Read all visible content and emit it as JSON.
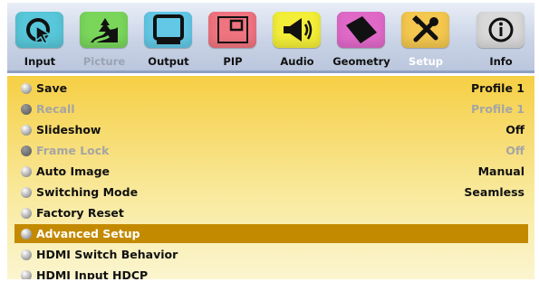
{
  "tabs": [
    {
      "label": "Input",
      "icon": "input-cursor-icon",
      "color": "#57c7d9"
    },
    {
      "label": "Picture",
      "icon": "picture-landscape-icon",
      "color": "#79d65b"
    },
    {
      "label": "Output",
      "icon": "output-monitor-icon",
      "color": "#62c8e6"
    },
    {
      "label": "PIP",
      "icon": "pip-window-icon",
      "color": "#f0747f"
    },
    {
      "label": "Audio",
      "icon": "audio-speaker-icon",
      "color": "#f3ee38"
    },
    {
      "label": "Geometry",
      "icon": "geometry-rhombus-icon",
      "color": "#e069c8"
    },
    {
      "label": "Setup",
      "icon": "setup-tools-icon",
      "color": "#f4c74f"
    },
    {
      "label": "Info",
      "icon": "info-icon",
      "color": "#d9d9d9"
    }
  ],
  "active_tab": "Setup",
  "menu": [
    {
      "label": "Save",
      "value": "Profile 1",
      "state": "enabled"
    },
    {
      "label": "Recall",
      "value": "Profile 1",
      "state": "disabled"
    },
    {
      "label": "Slideshow",
      "value": "Off",
      "state": "enabled"
    },
    {
      "label": "Frame Lock",
      "value": "Off",
      "state": "disabled"
    },
    {
      "label": "Auto Image",
      "value": "Manual",
      "state": "enabled"
    },
    {
      "label": "Switching Mode",
      "value": "Seamless",
      "state": "enabled"
    },
    {
      "label": "Factory Reset",
      "value": "",
      "state": "enabled"
    },
    {
      "label": "Advanced Setup",
      "value": "",
      "state": "selected"
    },
    {
      "label": "HDMI Switch Behavior",
      "value": "",
      "state": "enabled"
    },
    {
      "label": "HDMI Input HDCP",
      "value": "",
      "state": "enabled"
    }
  ]
}
